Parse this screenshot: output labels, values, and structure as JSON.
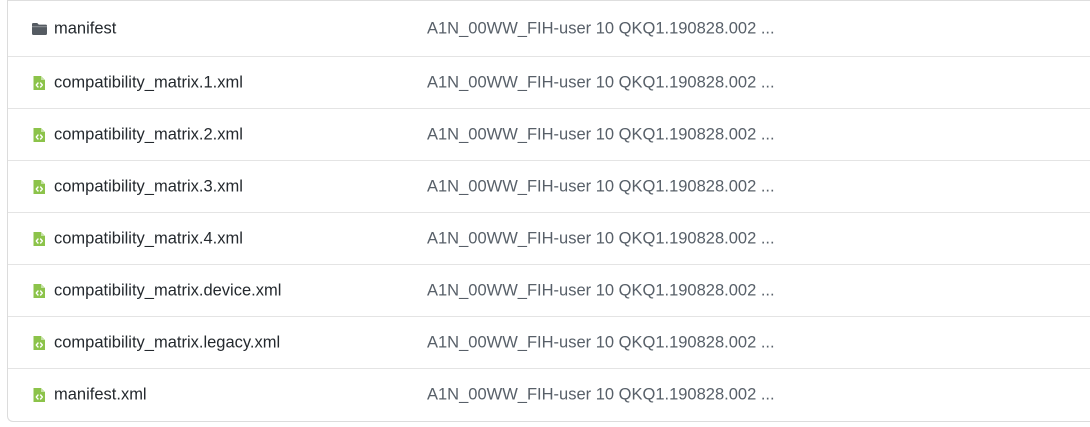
{
  "files": [
    {
      "type": "folder",
      "icon": "folder-icon",
      "name": "manifest",
      "commit_message": "A1N_00WW_FIH-user 10 QKQ1.190828.002 ..."
    },
    {
      "type": "file",
      "icon": "xml-file-icon",
      "name": "compatibility_matrix.1.xml",
      "commit_message": "A1N_00WW_FIH-user 10 QKQ1.190828.002 ..."
    },
    {
      "type": "file",
      "icon": "xml-file-icon",
      "name": "compatibility_matrix.2.xml",
      "commit_message": "A1N_00WW_FIH-user 10 QKQ1.190828.002 ..."
    },
    {
      "type": "file",
      "icon": "xml-file-icon",
      "name": "compatibility_matrix.3.xml",
      "commit_message": "A1N_00WW_FIH-user 10 QKQ1.190828.002 ..."
    },
    {
      "type": "file",
      "icon": "xml-file-icon",
      "name": "compatibility_matrix.4.xml",
      "commit_message": "A1N_00WW_FIH-user 10 QKQ1.190828.002 ..."
    },
    {
      "type": "file",
      "icon": "xml-file-icon",
      "name": "compatibility_matrix.device.xml",
      "commit_message": "A1N_00WW_FIH-user 10 QKQ1.190828.002 ..."
    },
    {
      "type": "file",
      "icon": "xml-file-icon",
      "name": "compatibility_matrix.legacy.xml",
      "commit_message": "A1N_00WW_FIH-user 10 QKQ1.190828.002 ..."
    },
    {
      "type": "file",
      "icon": "xml-file-icon",
      "name": "manifest.xml",
      "commit_message": "A1N_00WW_FIH-user 10 QKQ1.190828.002 ..."
    }
  ],
  "colors": {
    "folder_icon": "#555b62",
    "xml_icon": "#8cc34a",
    "file_name_text": "#24292e",
    "commit_text": "#586069"
  }
}
